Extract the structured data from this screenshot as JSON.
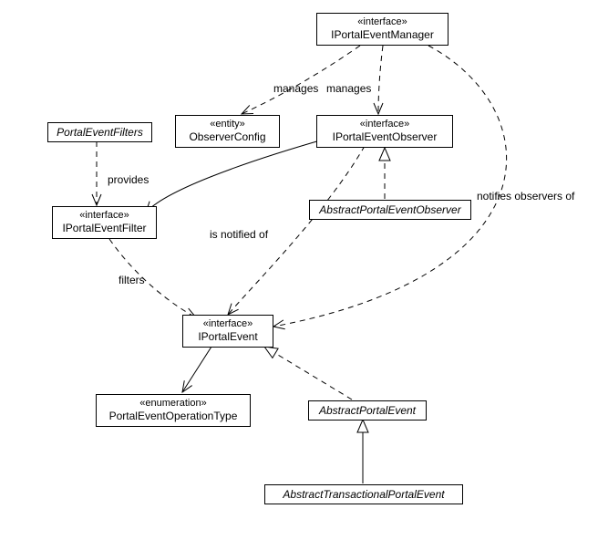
{
  "nodes": {
    "manager": {
      "stereo": "«interface»",
      "name": "IPortalEventManager"
    },
    "observer": {
      "stereo": "«interface»",
      "name": "IPortalEventObserver"
    },
    "config": {
      "stereo": "«entity»",
      "name": "ObserverConfig"
    },
    "filters": {
      "name": "PortalEventFilters"
    },
    "filter": {
      "stereo": "«interface»",
      "name": "IPortalEventFilter"
    },
    "absObs": {
      "name": "AbstractPortalEventObserver"
    },
    "event": {
      "stereo": "«interface»",
      "name": "IPortalEvent"
    },
    "opType": {
      "stereo": "«enumeration»",
      "name": "PortalEventOperationType"
    },
    "absEvt": {
      "name": "AbstractPortalEvent"
    },
    "absTxEvt": {
      "name": "AbstractTransactionalPortalEvent"
    }
  },
  "labels": {
    "managesL": "manages",
    "managesR": "manages",
    "provides": "provides",
    "notified": "is notified of",
    "notifies": "notifies observers of",
    "filters": "filters"
  }
}
